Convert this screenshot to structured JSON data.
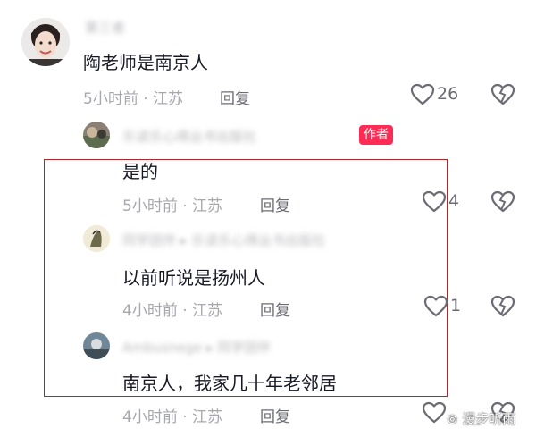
{
  "comments": [
    {
      "author": "第三者",
      "text": "陶老师是南京人",
      "time": "5小时前",
      "location": "江苏",
      "reply_label": "回复",
      "likes": "26"
    },
    {
      "author": "乐读乐心得丛书出版社",
      "badge": "作者",
      "text": "是的",
      "time": "5小时前",
      "location": "江苏",
      "reply_label": "回复",
      "likes": "4"
    },
    {
      "author": "同学团伴",
      "reply_to": "乐读乐心得丛书出版社",
      "text": "以前听说是扬州人",
      "time": "4小时前",
      "location": "江苏",
      "reply_label": "回复",
      "likes": "1"
    },
    {
      "author": "Ambusnege",
      "reply_to": "同学团伴",
      "text": "南京人，我家几十年老邻居",
      "time": "4小时前",
      "location": "江苏",
      "reply_label": "回复",
      "likes": ""
    }
  ],
  "separator": "·",
  "watermark": "漫步听雨",
  "colors": {
    "highlight": "#b3252a",
    "badge": "#fe2c55",
    "meta": "#a7a8ae"
  }
}
